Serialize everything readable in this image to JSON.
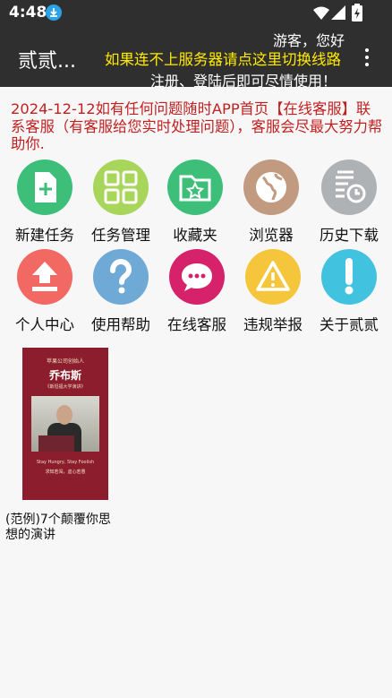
{
  "status": {
    "time": "4:48"
  },
  "appbar": {
    "title": "贰贰...",
    "guest": "游客，您好",
    "switch_line": "如果连不上服务器请点这里切换线路",
    "login_hint": "注册、登陆后即可尽情使用！"
  },
  "notice": "2024-12-12如有任何问题随时APP首页【在线客服】联系客服（有客服给您实时处理问题），客服会尽最大努力帮助你.",
  "menu": [
    {
      "label": "新建任务",
      "icon": "new-file-icon",
      "color": "#3dbf7a"
    },
    {
      "label": "任务管理",
      "icon": "grid-icon",
      "color": "#a7d65a"
    },
    {
      "label": "收藏夹",
      "icon": "star-folder-icon",
      "color": "#3dbf7a"
    },
    {
      "label": "浏览器",
      "icon": "globe-icon",
      "color": "#c19a80"
    },
    {
      "label": "历史下载",
      "icon": "history-icon",
      "color": "#aeb2b5"
    },
    {
      "label": "个人中心",
      "icon": "upload-icon",
      "color": "#f26863"
    },
    {
      "label": "使用帮助",
      "icon": "question-icon",
      "color": "#6fa9d6"
    },
    {
      "label": "在线客服",
      "icon": "chat-icon",
      "color": "#d6226b"
    },
    {
      "label": "违规举报",
      "icon": "warning-icon",
      "color": "#f5c63c"
    },
    {
      "label": "关于贰贰",
      "icon": "exclamation-icon",
      "color": "#41c3e0"
    }
  ],
  "document": {
    "cover": {
      "line1": "苹果公司创始人",
      "name": "乔布斯",
      "line2": "《斯坦福大学演讲》",
      "quote_en": "Stay Hungry, Stay Foolish",
      "quote_cn": "求知若渴，虚心若愚"
    },
    "title": "(范例)7个颠覆你思想的演讲"
  }
}
